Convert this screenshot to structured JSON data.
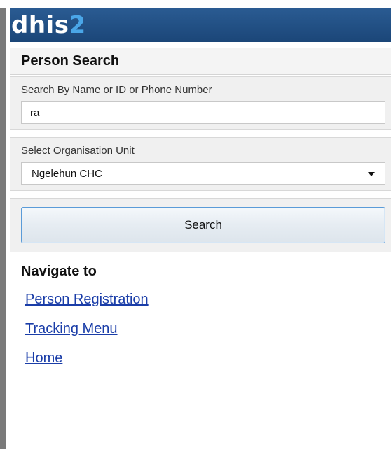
{
  "header": {
    "logo_main": "dhis",
    "logo_accent": "2"
  },
  "page": {
    "title": "Person Search"
  },
  "search": {
    "label": "Search By Name or ID or Phone Number",
    "value": "ra"
  },
  "org_unit": {
    "label": "Select Organisation Unit",
    "selected": "Ngelehun CHC"
  },
  "actions": {
    "search_label": "Search"
  },
  "nav": {
    "heading": "Navigate to",
    "links": [
      {
        "label": "Person Registration"
      },
      {
        "label": "Tracking Menu"
      },
      {
        "label": "Home"
      }
    ]
  },
  "colors": {
    "header_bg": "#1e4a7c",
    "logo_accent": "#4aa6e8",
    "link": "#1a3da8",
    "button_border": "#5a9bd8"
  }
}
